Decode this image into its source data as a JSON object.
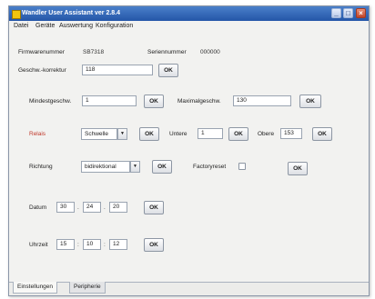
{
  "window": {
    "title": "Wandler User Assistant ver 2.8.4",
    "controls": {
      "minimize": "_",
      "maximize": "□",
      "close": "×"
    }
  },
  "menu": [
    "Datei",
    "Geräte",
    "Auswertung",
    "Konfiguration"
  ],
  "form": {
    "firmware_label": "Firmwarenummer",
    "firmware_value": "SB7318",
    "serial_label": "Seriennummer",
    "serial_value": "000000",
    "speed_correction_label": "Geschw.-korrektur",
    "speed_correction_value": "118",
    "min_speed_label": "Mindestgeschw.",
    "min_speed_value": "1",
    "max_speed_label": "Maximalgeschw.",
    "max_speed_value": "130",
    "relais_label": "Relais",
    "relais_mode": "Schwelle",
    "lower_label": "Untere",
    "lower_value": "1",
    "upper_label": "Obere",
    "upper_value": "153",
    "direction_label": "Richtung",
    "direction_value": "bidirektional",
    "factory_reset_label": "Factoryreset",
    "date_label": "Datum",
    "date_parts": [
      "30",
      "24",
      "20"
    ],
    "time_label": "Uhrzeit",
    "time_parts": [
      "15",
      "10",
      "12"
    ],
    "date_sep": ".",
    "time_sep": ":",
    "ok_label": "OK"
  },
  "tabs": [
    "Einstellungen",
    "Peripherie"
  ],
  "colors": {
    "title_bar": "#2456a8",
    "relais_label": "#c0392b"
  }
}
